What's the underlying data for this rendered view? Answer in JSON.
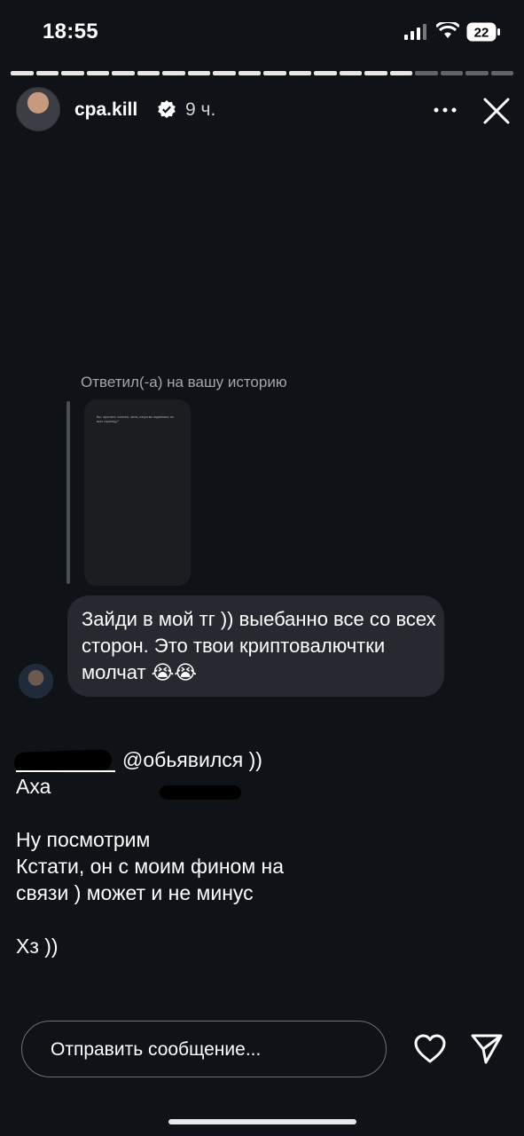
{
  "status_bar": {
    "time": "18:55",
    "battery": "22"
  },
  "story": {
    "segments_total": 20,
    "segments_done": 16,
    "username": "cpa.kill",
    "time_ago": "9 ч."
  },
  "reply": {
    "label": "Ответил(-а) на вашу историю",
    "story_preview_text": "Вы, простите, конечно, меня, нахуя вы подписаны на мою страницу?",
    "message": "Зайди в мой тг )) выебанно все со всех сторон. Это твои криптовалючтки молчат 😭😭"
  },
  "overlay": {
    "line1": "@обьявился ))",
    "line2": "Аха",
    "line3": "Ну посмотрим",
    "line4": "Кстати, он с моим фином на",
    "line5": "связи ) может и не минус",
    "line6": "Хз ))"
  },
  "composer": {
    "placeholder": "Отправить сообщение..."
  },
  "icons": {
    "verified": "verified-badge-icon",
    "more": "more-icon",
    "close": "close-icon",
    "like": "heart-icon",
    "send": "send-icon"
  }
}
